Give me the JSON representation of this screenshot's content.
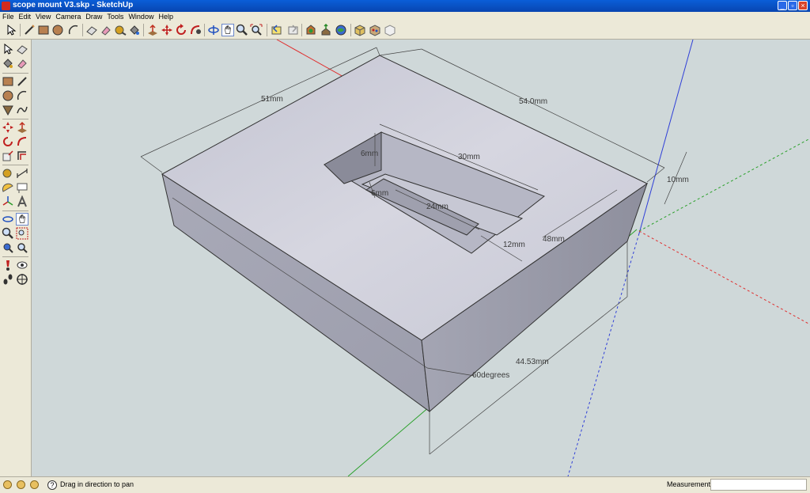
{
  "window": {
    "title": "scope mount V3.skp - SketchUp"
  },
  "menu": [
    "File",
    "Edit",
    "View",
    "Camera",
    "Draw",
    "Tools",
    "Window",
    "Help"
  ],
  "dimensions": {
    "d51": "51mm",
    "d54": "54.0mm",
    "d30": "30mm",
    "d6a": "6mm",
    "d6b": "6mm",
    "d24": "24mm",
    "d12": "12mm",
    "d48": "48mm",
    "d10": "10mm",
    "d4453": "44.53mm",
    "angle": "60degrees"
  },
  "status": {
    "hint": "Drag in direction to pan",
    "measurements_label": "Measurements",
    "measurements_value": ""
  },
  "colors": {
    "viewport_bg": "#cfd8d9",
    "axis_red": "#e03030",
    "axis_green": "#2aa02a",
    "axis_blue": "#2f3fd8"
  }
}
